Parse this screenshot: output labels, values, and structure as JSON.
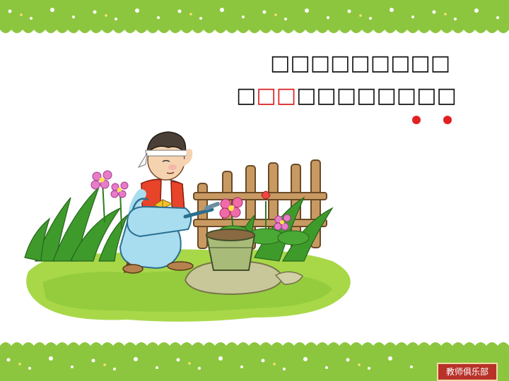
{
  "slide": {
    "line_1": "□□□□□□□□□",
    "line_2_lead": "□",
    "line_2_highlight": "□□",
    "line_2_rest": "□□□□□□□□",
    "logo_text": "教师俱乐部"
  },
  "colors": {
    "border_green": "#8cc63f",
    "highlight_red": "#d81e1e",
    "dot_red": "#e32020",
    "logo_red": "#b8322a"
  },
  "icons": {
    "illustration": "boy-watering-plant-illustration",
    "logo": "teacher-club-logo"
  }
}
